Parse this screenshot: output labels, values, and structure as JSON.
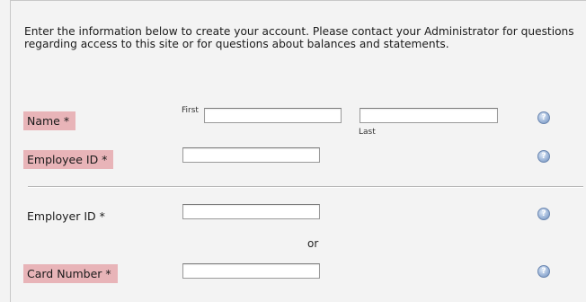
{
  "intro": {
    "text": "Enter the information below to create your account. Please contact your Administrator for questions regarding access to this site or for questions about balances and statements."
  },
  "form": {
    "name": {
      "label": "Name *",
      "first_caption": "First",
      "last_caption": "Last",
      "first_value": "",
      "last_value": ""
    },
    "employee_id": {
      "label": "Employee ID *",
      "value": ""
    },
    "employer_id": {
      "label": "Employer ID *",
      "value": ""
    },
    "or_text": "or",
    "card_number": {
      "label": "Card Number *",
      "value": ""
    }
  },
  "help_icon_glyph": "?",
  "colors": {
    "required_highlight": "#e8b4b8",
    "background": "#f3f3f3"
  }
}
